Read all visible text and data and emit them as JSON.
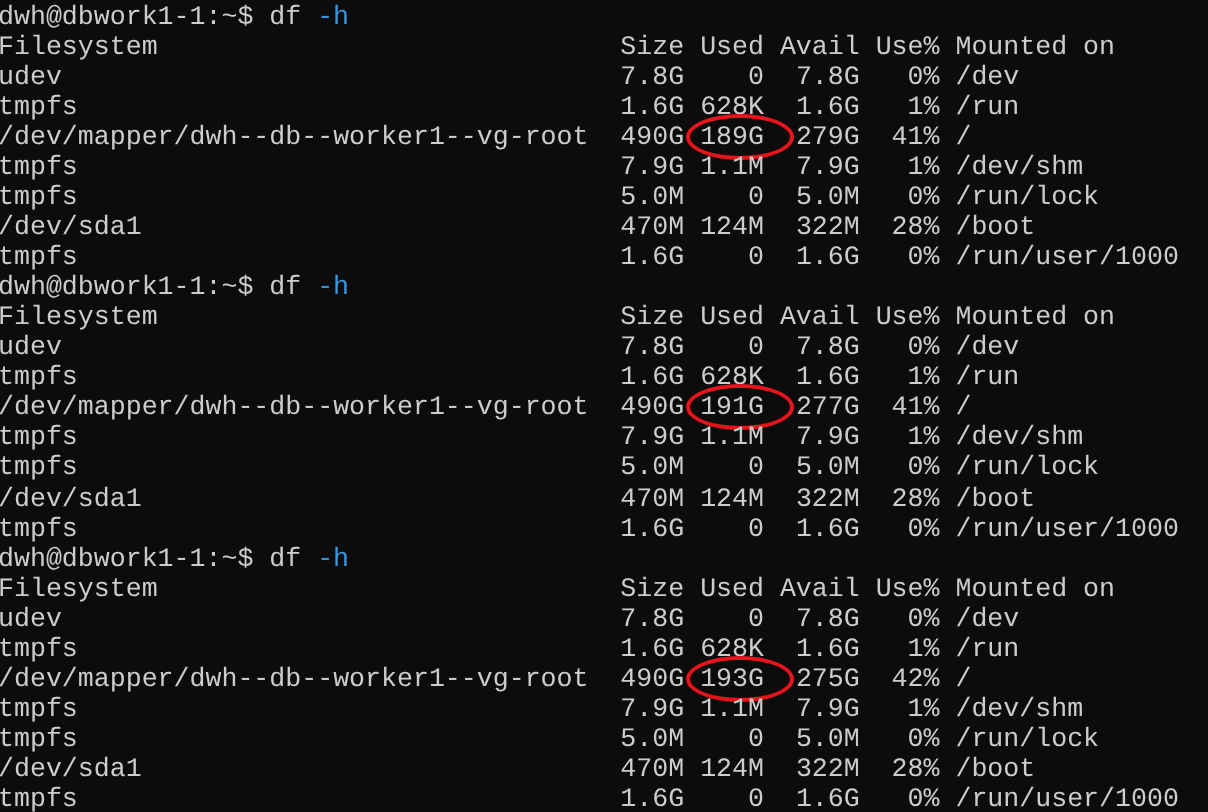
{
  "blocks": [
    {
      "prompt": "dwh@dbwork1-1:~$",
      "command": "df",
      "flag": "-h",
      "columns": [
        "Filesystem",
        "Size",
        "Used",
        "Avail",
        "Use%",
        "Mounted on"
      ],
      "rows": [
        {
          "cells": [
            "udev",
            "7.8G",
            "0",
            "7.8G",
            "0%",
            "/dev"
          ],
          "circled": false
        },
        {
          "cells": [
            "tmpfs",
            "1.6G",
            "628K",
            "1.6G",
            "1%",
            "/run"
          ],
          "circled": false
        },
        {
          "cells": [
            "/dev/mapper/dwh--db--worker1--vg-root",
            "490G",
            "189G",
            "279G",
            "41%",
            "/"
          ],
          "circled": true
        },
        {
          "cells": [
            "tmpfs",
            "7.9G",
            "1.1M",
            "7.9G",
            "1%",
            "/dev/shm"
          ],
          "circled": false
        },
        {
          "cells": [
            "tmpfs",
            "5.0M",
            "0",
            "5.0M",
            "0%",
            "/run/lock"
          ],
          "circled": false
        },
        {
          "cells": [
            "/dev/sda1",
            "470M",
            "124M",
            "322M",
            "28%",
            "/boot"
          ],
          "circled": false
        },
        {
          "cells": [
            "tmpfs",
            "1.6G",
            "0",
            "1.6G",
            "0%",
            "/run/user/1000"
          ],
          "circled": false
        }
      ]
    },
    {
      "prompt": "dwh@dbwork1-1:~$",
      "command": "df",
      "flag": "-h",
      "columns": [
        "Filesystem",
        "Size",
        "Used",
        "Avail",
        "Use%",
        "Mounted on"
      ],
      "rows": [
        {
          "cells": [
            "udev",
            "7.8G",
            "0",
            "7.8G",
            "0%",
            "/dev"
          ],
          "circled": false
        },
        {
          "cells": [
            "tmpfs",
            "1.6G",
            "628K",
            "1.6G",
            "1%",
            "/run"
          ],
          "circled": false
        },
        {
          "cells": [
            "/dev/mapper/dwh--db--worker1--vg-root",
            "490G",
            "191G",
            "277G",
            "41%",
            "/"
          ],
          "circled": true
        },
        {
          "cells": [
            "tmpfs",
            "7.9G",
            "1.1M",
            "7.9G",
            "1%",
            "/dev/shm"
          ],
          "circled": false
        },
        {
          "cells": [
            "tmpfs",
            "5.0M",
            "0",
            "5.0M",
            "0%",
            "/run/lock"
          ],
          "circled": false
        },
        {
          "cells": [
            "/dev/sda1",
            "470M",
            "124M",
            "322M",
            "28%",
            "/boot"
          ],
          "circled": false
        },
        {
          "cells": [
            "tmpfs",
            "1.6G",
            "0",
            "1.6G",
            "0%",
            "/run/user/1000"
          ],
          "circled": false
        }
      ]
    },
    {
      "prompt": "dwh@dbwork1-1:~$",
      "command": "df",
      "flag": "-h",
      "columns": [
        "Filesystem",
        "Size",
        "Used",
        "Avail",
        "Use%",
        "Mounted on"
      ],
      "rows": [
        {
          "cells": [
            "udev",
            "7.8G",
            "0",
            "7.8G",
            "0%",
            "/dev"
          ],
          "circled": false
        },
        {
          "cells": [
            "tmpfs",
            "1.6G",
            "628K",
            "1.6G",
            "1%",
            "/run"
          ],
          "circled": false
        },
        {
          "cells": [
            "/dev/mapper/dwh--db--worker1--vg-root",
            "490G",
            "193G",
            "275G",
            "42%",
            "/"
          ],
          "circled": true
        },
        {
          "cells": [
            "tmpfs",
            "7.9G",
            "1.1M",
            "7.9G",
            "1%",
            "/dev/shm"
          ],
          "circled": false
        },
        {
          "cells": [
            "tmpfs",
            "5.0M",
            "0",
            "5.0M",
            "0%",
            "/run/lock"
          ],
          "circled": false
        },
        {
          "cells": [
            "/dev/sda1",
            "470M",
            "124M",
            "322M",
            "28%",
            "/boot"
          ],
          "circled": false
        },
        {
          "cells": [
            "tmpfs",
            "1.6G",
            "0",
            "1.6G",
            "0%",
            "/run/user/1000"
          ],
          "circled": false
        }
      ]
    }
  ]
}
